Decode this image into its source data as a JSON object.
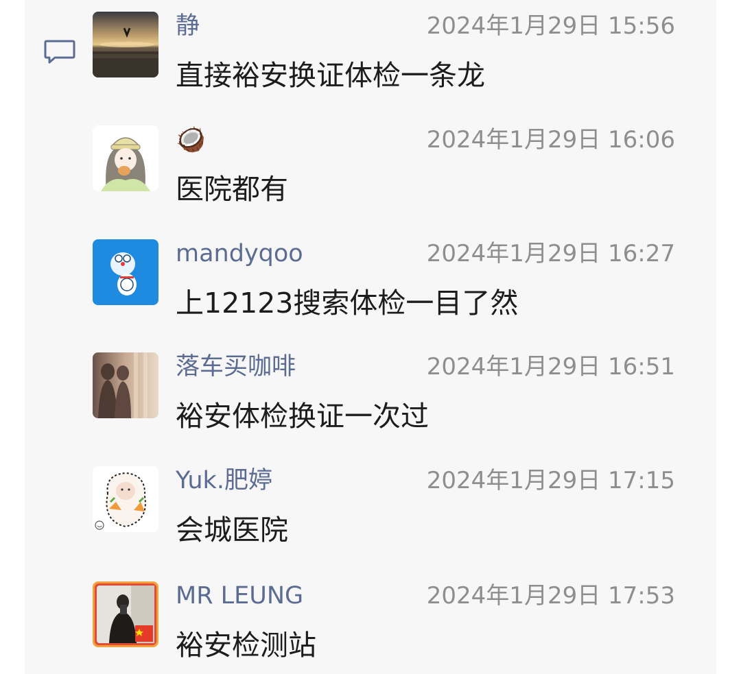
{
  "comments": [
    {
      "nickname": "静",
      "time": "2024年1月29日 15:56",
      "text": "直接裕安换证体检一条龙",
      "avatar_icon": "sunset-beach-photo-avatar"
    },
    {
      "nickname": "🥥",
      "time": "2024年1月29日 16:06",
      "text": "医院都有",
      "avatar_icon": "illustrated-girl-avatar"
    },
    {
      "nickname": "mandyqoo",
      "time": "2024年1月29日 16:27",
      "text": "上12123搜索体检一目了然",
      "avatar_icon": "doraemon-avatar"
    },
    {
      "nickname": "落车买咖啡",
      "time": "2024年1月29日 16:51",
      "text": "裕安体检换证一次过",
      "avatar_icon": "shadow-silhouette-avatar"
    },
    {
      "nickname": "Yuk.肥婷",
      "time": "2024年1月29日 17:15",
      "text": "会城医院",
      "avatar_icon": "baby-sticker-avatar"
    },
    {
      "nickname": "MR LEUNG",
      "time": "2024年1月29日 17:53",
      "text": "裕安检测站",
      "avatar_icon": "mirror-selfie-flag-avatar"
    }
  ],
  "colors": {
    "panel_bg": "#f7f7f7",
    "nickname": "#5b6b92",
    "timestamp": "#8e8e8e",
    "message": "#1c1c1c",
    "icon": "#5b6b92"
  }
}
